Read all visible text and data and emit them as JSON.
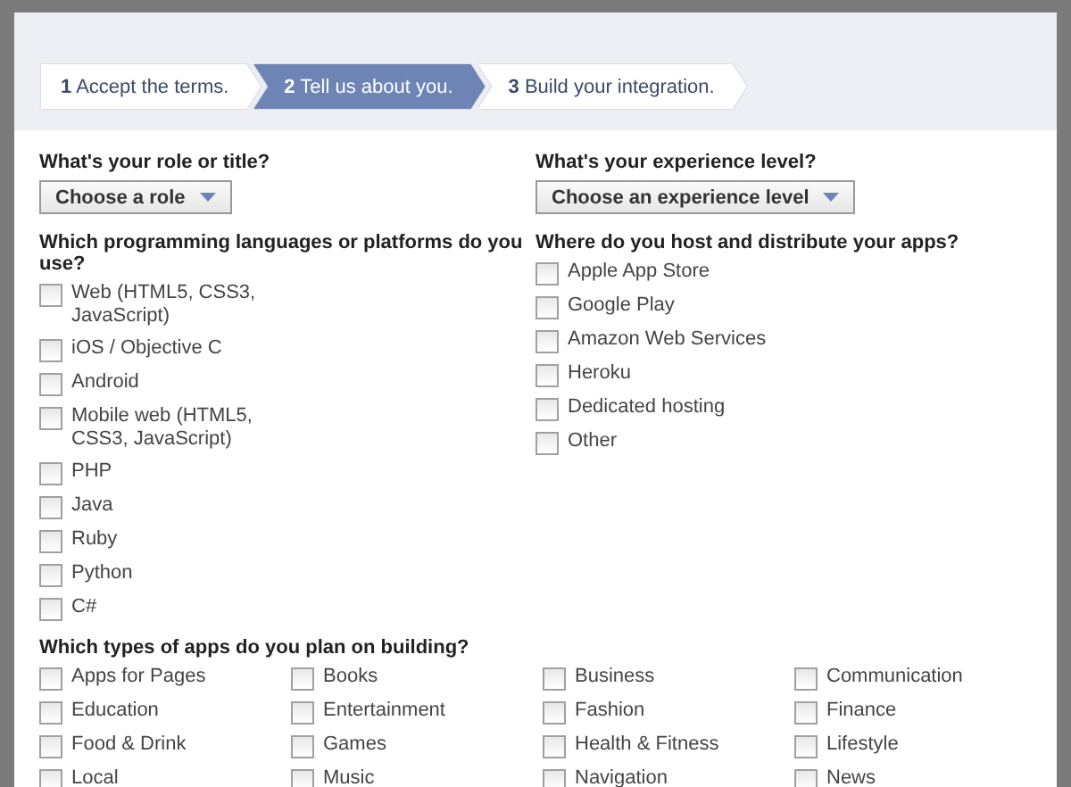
{
  "steps": [
    {
      "label": "**1** Accept the terms.",
      "selected": false
    },
    {
      "label": "**2** Tell us about you.",
      "selected": true
    },
    {
      "label": "**3** Build your integration.",
      "selected": false
    }
  ],
  "role": {
    "label": "What's your role or title?",
    "dropdown": "Choose a role"
  },
  "experience": {
    "label": "What's your experience level?",
    "dropdown": "Choose an experience level"
  },
  "languages": {
    "label": "Which programming languages or platforms do you use?",
    "options": [
      {
        "label": "Web (HTML5, CSS3, JavaScript)",
        "checked": false
      },
      {
        "label": "iOS / Objective C",
        "checked": false
      },
      {
        "label": "Android",
        "checked": false
      },
      {
        "label": "Mobile web (HTML5, CSS3, JavaScript)",
        "checked": false
      },
      {
        "label": "PHP",
        "checked": false
      },
      {
        "label": "Java",
        "checked": false
      },
      {
        "label": "Ruby",
        "checked": false
      },
      {
        "label": "Python",
        "checked": false
      },
      {
        "label": "C#",
        "checked": false
      }
    ]
  },
  "hosting": {
    "label": "Where do you host and distribute your apps?",
    "options": [
      {
        "label": "Apple App Store",
        "checked": false
      },
      {
        "label": "Google Play",
        "checked": false
      },
      {
        "label": "Amazon Web Services",
        "checked": false
      },
      {
        "label": "Heroku",
        "checked": false
      },
      {
        "label": "Dedicated hosting",
        "checked": false
      },
      {
        "label": "Other",
        "checked": false
      }
    ]
  },
  "app_types": {
    "label": "Which types of apps do you plan on building?",
    "options": [
      {
        "label": "Apps for Pages",
        "checked": false
      },
      {
        "label": "Books",
        "checked": false
      },
      {
        "label": "Business",
        "checked": false
      },
      {
        "label": "Communication",
        "checked": false
      },
      {
        "label": "Education",
        "checked": false
      },
      {
        "label": "Entertainment",
        "checked": false
      },
      {
        "label": "Fashion",
        "checked": false
      },
      {
        "label": "Finance",
        "checked": false
      },
      {
        "label": "Food & Drink",
        "checked": false
      },
      {
        "label": "Games",
        "checked": false
      },
      {
        "label": "Health & Fitness",
        "checked": false
      },
      {
        "label": "Lifestyle",
        "checked": false
      },
      {
        "label": "Local",
        "checked": false
      },
      {
        "label": "Music",
        "checked": false
      },
      {
        "label": "Navigation",
        "checked": false
      },
      {
        "label": "News",
        "checked": false
      }
    ]
  }
}
